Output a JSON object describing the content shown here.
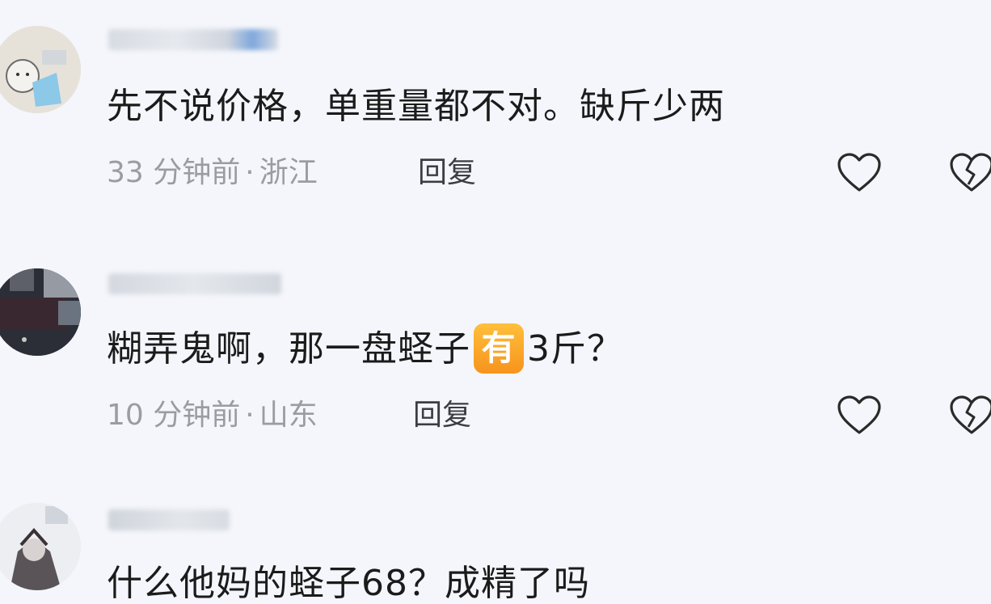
{
  "comments": [
    {
      "text": "先不说价格，单重量都不对。缺斤少两",
      "time": "33 分钟前",
      "separator": "·",
      "location": "浙江",
      "reply_label": "回复"
    },
    {
      "text_before": "糊弄鬼啊，那一盘蛏子",
      "emoji_char": "有",
      "text_after": "3斤？",
      "time": "10 分钟前",
      "separator": "·",
      "location": "山东",
      "reply_label": "回复"
    },
    {
      "text": "什么他妈的蛏子68？成精了吗"
    }
  ],
  "colors": {
    "text": "#1b1b1b",
    "meta": "#9a9ca3",
    "emoji_badge": "#f7a228"
  },
  "icons": [
    "heart-outline-icon",
    "broken-heart-icon"
  ]
}
